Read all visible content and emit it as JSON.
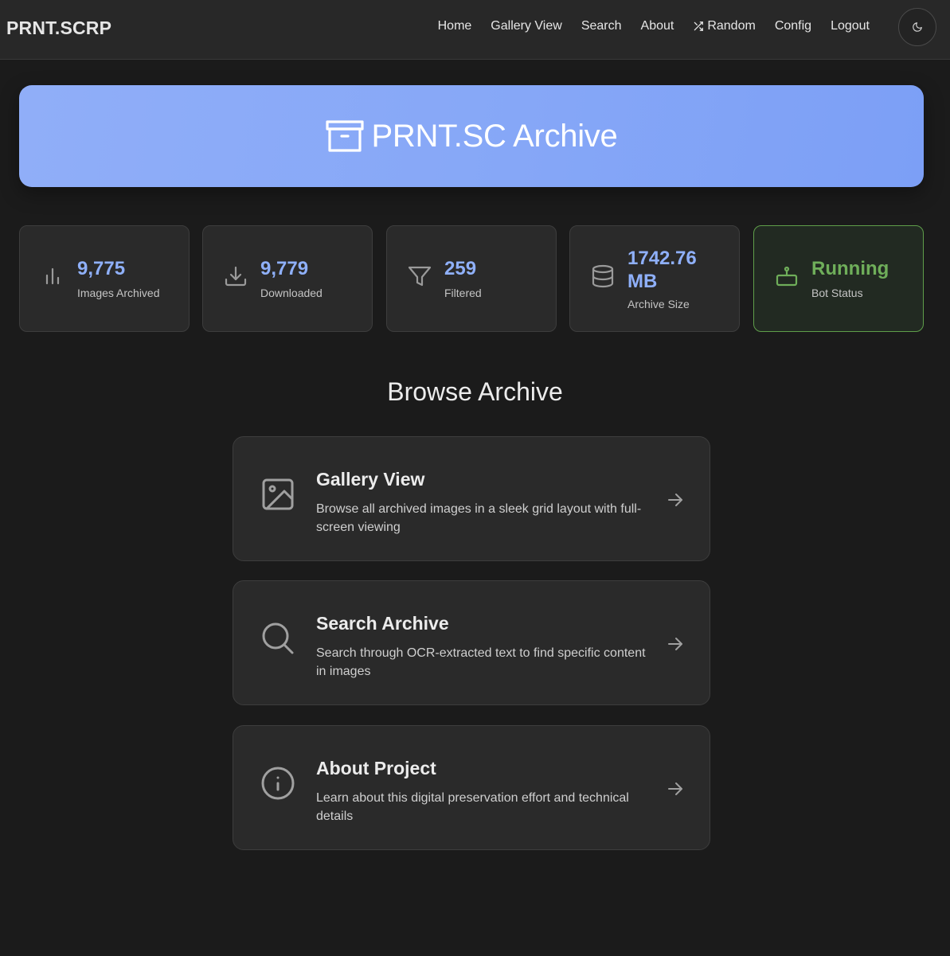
{
  "nav": {
    "brand": "PRNT.SCRP",
    "links": [
      {
        "label": "Home"
      },
      {
        "label": "Gallery View"
      },
      {
        "label": "Search"
      },
      {
        "label": "About"
      },
      {
        "label": "Random",
        "icon": "shuffle-icon"
      },
      {
        "label": "Config"
      },
      {
        "label": "Logout"
      }
    ],
    "theme_toggle_icon": "moon-icon"
  },
  "hero": {
    "title": "PRNT.SC Archive",
    "icon": "archive-icon",
    "gradient": [
      "#90aef8",
      "#7c9ff6"
    ]
  },
  "stats": [
    {
      "value": "9,775",
      "label": "Images Archived",
      "icon": "bar-chart-icon"
    },
    {
      "value": "9,779",
      "label": "Downloaded",
      "icon": "download-icon"
    },
    {
      "value": "259",
      "label": "Filtered",
      "icon": "filter-icon"
    },
    {
      "value": "1742.76 MB",
      "label": "Archive Size",
      "icon": "database-icon"
    },
    {
      "value": "Running",
      "label": "Bot Status",
      "icon": "robot-icon",
      "status_color": "#6fae5a"
    }
  ],
  "browse": {
    "title": "Browse Archive",
    "cards": [
      {
        "title": "Gallery View",
        "description": "Browse all archived images in a sleek grid layout with full-screen viewing",
        "icon": "image-icon"
      },
      {
        "title": "Search Archive",
        "description": "Search through OCR-extracted text to find specific content in images",
        "icon": "search-icon"
      },
      {
        "title": "About Project",
        "description": "Learn about this digital preservation effort and technical details",
        "icon": "info-icon"
      }
    ]
  },
  "colors": {
    "accent": "#8fb0fa",
    "background": "#1b1b1b",
    "card": "#2a2a2a",
    "success": "#6fae5a"
  }
}
